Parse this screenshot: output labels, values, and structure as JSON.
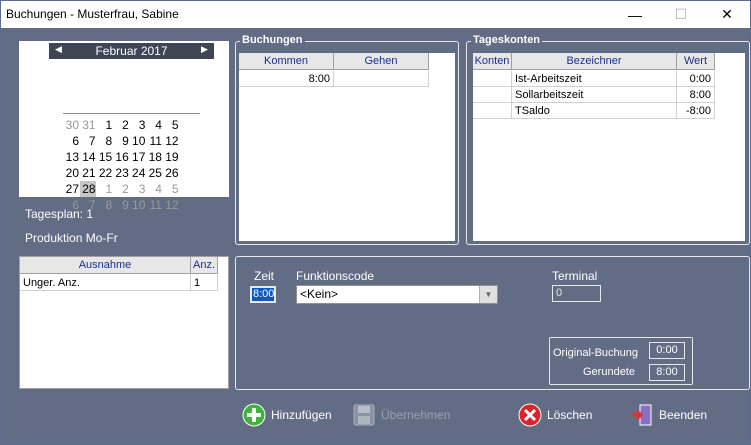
{
  "window": {
    "title": "Buchungen - Musterfrau, Sabine",
    "minimize": "—",
    "maximize": "☐",
    "close": "✕"
  },
  "calendar": {
    "month": "Februar 2017",
    "prev": "◀",
    "next": "▶",
    "weeks": [
      [
        {
          "d": "30",
          "o": true
        },
        {
          "d": "31",
          "o": true
        },
        {
          "d": "1"
        },
        {
          "d": "2"
        },
        {
          "d": "3"
        },
        {
          "d": "4"
        },
        {
          "d": "5"
        }
      ],
      [
        {
          "d": "6"
        },
        {
          "d": "7"
        },
        {
          "d": "8"
        },
        {
          "d": "9"
        },
        {
          "d": "10"
        },
        {
          "d": "11"
        },
        {
          "d": "12"
        }
      ],
      [
        {
          "d": "13"
        },
        {
          "d": "14"
        },
        {
          "d": "15"
        },
        {
          "d": "16"
        },
        {
          "d": "17"
        },
        {
          "d": "18"
        },
        {
          "d": "19"
        }
      ],
      [
        {
          "d": "20"
        },
        {
          "d": "21"
        },
        {
          "d": "22"
        },
        {
          "d": "23"
        },
        {
          "d": "24"
        },
        {
          "d": "25"
        },
        {
          "d": "26"
        }
      ],
      [
        {
          "d": "27"
        },
        {
          "d": "28",
          "s": true
        },
        {
          "d": "1",
          "o": true
        },
        {
          "d": "2",
          "o": true
        },
        {
          "d": "3",
          "o": true
        },
        {
          "d": "4",
          "o": true
        },
        {
          "d": "5",
          "o": true
        }
      ],
      [
        {
          "d": "6",
          "o": true
        },
        {
          "d": "7",
          "o": true
        },
        {
          "d": "8",
          "o": true
        },
        {
          "d": "9",
          "o": true
        },
        {
          "d": "10",
          "o": true
        },
        {
          "d": "11",
          "o": true
        },
        {
          "d": "12",
          "o": true
        }
      ]
    ]
  },
  "tagesplan": "Tagesplan: 1",
  "produktion": "Produktion Mo-Fr",
  "ausnahme": {
    "headers": [
      "Ausnahme",
      "Anz."
    ],
    "rows": [
      [
        "Unger. Anz.",
        "1"
      ]
    ]
  },
  "buchungen": {
    "label": "Buchungen",
    "headers": [
      "Kommen",
      "Gehen"
    ],
    "rows": [
      [
        "8:00",
        ""
      ]
    ]
  },
  "tageskonten": {
    "label": "Tageskonten",
    "headers": [
      "Konten",
      "Bezeichner",
      "Wert"
    ],
    "rows": [
      [
        "",
        "Ist-Arbeitszeit",
        "0:00"
      ],
      [
        "",
        "Sollarbeitszeit",
        "8:00"
      ],
      [
        "",
        "TSaldo",
        "-8:00"
      ]
    ]
  },
  "form": {
    "zeit_label": "Zeit",
    "zeit_value": "8:00",
    "funktionscode_label": "Funktionscode",
    "funktionscode_value": "<Kein>",
    "terminal_label": "Terminal",
    "terminal_value": "0",
    "original_label": "Original-Buchung",
    "original_value": "0:00",
    "gerundete_label": "Gerundete",
    "gerundete_value": "8:00"
  },
  "toolbar": {
    "add": "Hinzufügen",
    "apply": "Übernehmen",
    "delete": "Löschen",
    "exit": "Beenden"
  },
  "colors": {
    "background": "#636c85",
    "accent": "#0a58c8",
    "header_text": "#1a2f8a"
  }
}
